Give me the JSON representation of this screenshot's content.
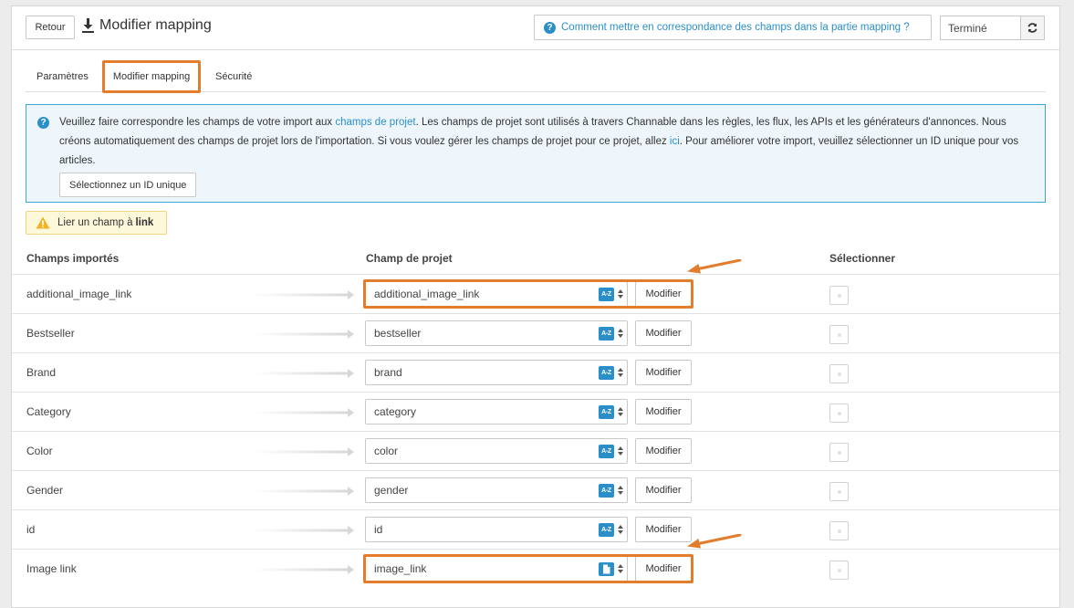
{
  "header": {
    "back_label": "Retour",
    "title": "Modifier mapping",
    "help_link": "Comment mettre en correspondance des champs dans la partie mapping ?",
    "status_value": "Terminé"
  },
  "tabs": [
    {
      "label": "Paramètres",
      "active": false
    },
    {
      "label": "Modifier mapping",
      "active": true
    },
    {
      "label": "Sécurité",
      "active": false
    }
  ],
  "info": {
    "text_1": "Veuillez faire correspondre les champs de votre import aux ",
    "link_1": "champs de projet",
    "text_2": ". Les champs de projet sont utilisés à travers Channable dans les règles, les flux, les APIs et les générateurs d'annonces. Nous créons automatiquement des champs de projet lors de l'importation. Si vous voulez gérer les champs de projet pour ce projet, allez ",
    "link_2": "ici",
    "text_3": ". Pour améliorer votre import, veuillez sélectionner un ID unique pour vos articles.",
    "unique_id_button": "Sélectionnez un ID unique"
  },
  "warning": {
    "text": "Lier un champ à",
    "field": "link"
  },
  "columns": {
    "imported": "Champs importés",
    "project": "Champ de projet",
    "select": "Sélectionner"
  },
  "modify_label": "Modifier",
  "rows": [
    {
      "source": "additional_image_link",
      "target": "additional_image_link",
      "badge": "A-Z",
      "highlighted": true
    },
    {
      "source": "Bestseller",
      "target": "bestseller",
      "badge": "A-Z",
      "highlighted": false
    },
    {
      "source": "Brand",
      "target": "brand",
      "badge": "A-Z",
      "highlighted": false
    },
    {
      "source": "Category",
      "target": "category",
      "badge": "A-Z",
      "highlighted": false
    },
    {
      "source": "Color",
      "target": "color",
      "badge": "A-Z",
      "highlighted": false
    },
    {
      "source": "Gender",
      "target": "gender",
      "badge": "A-Z",
      "highlighted": false
    },
    {
      "source": "id",
      "target": "id",
      "badge": "A-Z",
      "highlighted": false
    },
    {
      "source": "Image link",
      "target": "image_link",
      "badge": "file-icon",
      "highlighted": true
    }
  ],
  "colors": {
    "accent": "#2a8fc8",
    "highlight": "#e27d2d",
    "warning_bg": "#fcf8d9"
  }
}
